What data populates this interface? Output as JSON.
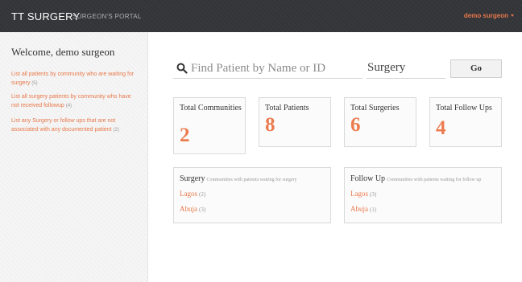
{
  "header": {
    "brand": "TT SURGERY",
    "subtitle": "SURGEON'S PORTAL",
    "user": "demo surgeon"
  },
  "sidebar": {
    "welcome": "Welcome, demo surgeon",
    "links": [
      {
        "label": "List all patients by community who are waiting for surgery",
        "count": "(5)"
      },
      {
        "label": "List all surgery patients by community who have not received followup",
        "count": "(4)"
      },
      {
        "label": "List any Surgery or follow ups that are not associated with any documented patient",
        "count": "(2)"
      }
    ]
  },
  "search": {
    "placeholder": "Find Patient by Name or ID",
    "selected_type": "Surgery",
    "go_label": "Go"
  },
  "stats": [
    {
      "label": "Total Communities",
      "value": "2"
    },
    {
      "label": "Total Patients",
      "value": "8"
    },
    {
      "label": "Total Surgeries",
      "value": "6"
    },
    {
      "label": "Total Follow Ups",
      "value": "4"
    }
  ],
  "panels": [
    {
      "title": "Surgery",
      "subtitle": "Communities with patients waiting for surgery",
      "rows": [
        {
          "name": "Lagos",
          "count": "(2)"
        },
        {
          "name": "Abuja",
          "count": "(3)"
        }
      ]
    },
    {
      "title": "Follow Up",
      "subtitle": "Communities with patients waiting for follow up",
      "rows": [
        {
          "name": "Lagos",
          "count": "(3)"
        },
        {
          "name": "Abuja",
          "count": "(1)"
        }
      ]
    }
  ],
  "colors": {
    "accent": "#ec7b50",
    "header_bg": "#333438",
    "sidebar_bg": "#f6f6f6"
  },
  "icons": {
    "search": "search-icon",
    "user_menu": "chevron-down-icon"
  }
}
